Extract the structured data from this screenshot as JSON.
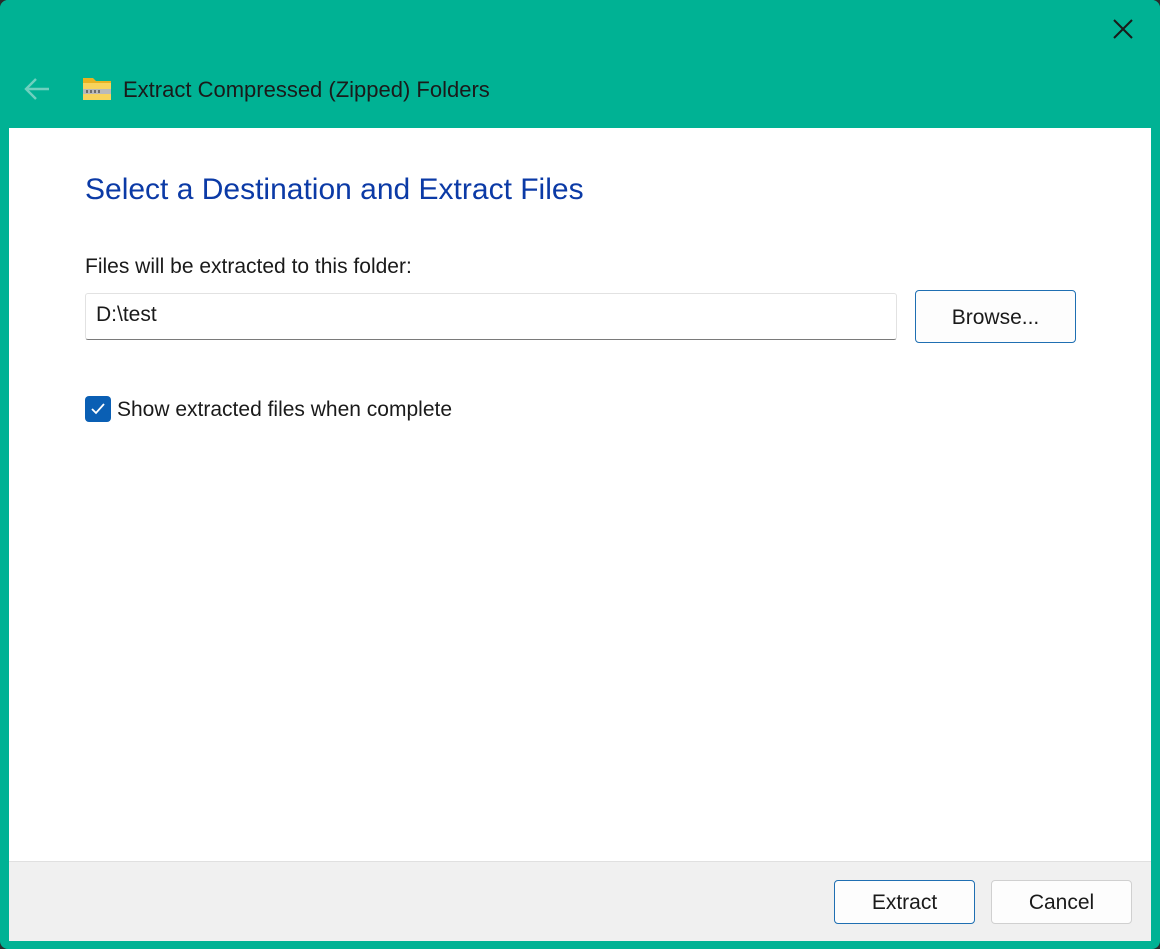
{
  "window": {
    "title": "Extract Compressed (Zipped) Folders",
    "accent_color": "#00b294",
    "close_icon": "close-icon",
    "back_icon": "back-arrow-icon",
    "app_icon": "zip-folder-icon"
  },
  "main": {
    "heading": "Select a Destination and Extract Files",
    "heading_color": "#0b3aa6",
    "destination_label": "Files will be extracted to this folder:",
    "destination_value": "D:\\test",
    "browse_label": "Browse...",
    "show_files_label": "Show extracted files when complete",
    "show_files_checked": true
  },
  "footer": {
    "extract_label": "Extract",
    "cancel_label": "Cancel"
  }
}
